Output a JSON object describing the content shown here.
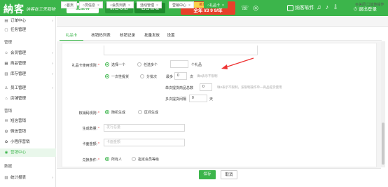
{
  "topbar": {
    "logo": "納客",
    "slogan": "讷客在工天我物",
    "login_btn": "要撒嗨",
    "front_btn": "前台收银",
    "back_btn": "后台管理",
    "promo_line1": "新年抢先购",
    "promo_line2": "全年 ¥3 9 9/年",
    "brand": "纳客软件",
    "logout": "退出登录",
    "accent": "#3cb54b"
  },
  "sidebar": {
    "items": [
      {
        "label": "订单中心",
        "icon": "order-icon",
        "arrow": "›"
      },
      {
        "label": "任务管理",
        "icon": "task-icon",
        "arrow": ""
      },
      {
        "label": "会员管理",
        "icon": "member-icon",
        "arrow": "›"
      },
      {
        "label": "商品管理",
        "icon": "goods-icon",
        "arrow": "›"
      },
      {
        "label": "库存管理",
        "icon": "stock-icon",
        "arrow": "›"
      },
      {
        "label": "员工管理",
        "icon": "staff-icon",
        "arrow": "›"
      },
      {
        "label": "店铺管理",
        "icon": "shop-icon",
        "arrow": ""
      },
      {
        "label": "短信营销",
        "icon": "sms-icon",
        "arrow": ""
      },
      {
        "label": "微信营销",
        "icon": "wechat-icon",
        "arrow": ""
      },
      {
        "label": "小程序营销",
        "icon": "miniapp-icon",
        "arrow": ""
      },
      {
        "label": "营销中心",
        "icon": "marketing-icon",
        "arrow": ""
      },
      {
        "label": "统计报表",
        "icon": "report-icon",
        "arrow": "›"
      }
    ],
    "headers": [
      "管理",
      "营销",
      "数据"
    ]
  },
  "tabs": {
    "items": [
      "首页",
      "员信息",
      "会员列表",
      "活动管理",
      "营销中心",
      "礼品卡"
    ],
    "close_all": "关闭",
    "other": "其他操作"
  },
  "inner_tabs": [
    "礼品卡",
    "核销码列表",
    "核销记录",
    "批量发放",
    "设置"
  ],
  "form": {
    "rule_label": "礼品卡使用规则:",
    "opt_single": "选择一个",
    "opt_multi": "任选多个",
    "gift_count_value": "",
    "gift_count_unit": "个礼品",
    "opt_once": "一次性提货",
    "opt_split": "分批次",
    "max_label": "最多",
    "max_value": "0",
    "max_unit": "次",
    "max_hint": "填0表示不限制",
    "single_total_label": "单次提货商品总数",
    "single_total_value": "0",
    "single_total_hint": "填0表示不限制，该限制操作单一商品提货使用",
    "interval_label": "多次提货间隔",
    "interval_value": "0",
    "interval_unit": "天",
    "verify_label": "核销码规则:",
    "verify_random": "随机生成",
    "verify_range": "区间生成",
    "qty_label": "生成数量:",
    "qty_placeholder": "发行总量",
    "amount_label": "卡面金额:",
    "amount_placeholder": "卡面金额",
    "cond_label": "兑换条件:",
    "cond_all": "所有人",
    "cond_level": "指定会员等级"
  },
  "footer": {
    "save": "保存",
    "cancel": "取消"
  }
}
